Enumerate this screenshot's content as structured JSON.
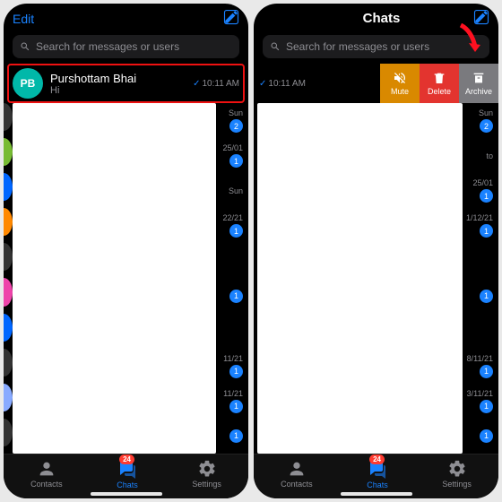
{
  "header": {
    "edit": "Edit",
    "title": "Chats"
  },
  "search": {
    "placeholder": "Search for messages or users"
  },
  "chat": {
    "initials": "PB",
    "name": "Purshottam Bhai",
    "preview": "Hi",
    "timestamp": "10:11 AM",
    "avatar_color": "#00b8a9"
  },
  "swipe": {
    "mute": "Mute",
    "delete": "Delete",
    "archive": "Archive"
  },
  "side_items": [
    {
      "date": "Sun",
      "count": 2
    },
    {
      "date": "25/01",
      "count": 1
    },
    {
      "date": "Sun",
      "count": ""
    },
    {
      "date": "22/21",
      "count": 1
    },
    {
      "date": "",
      "count": ""
    },
    {
      "date": "",
      "count": 1
    },
    {
      "date": "",
      "count": ""
    },
    {
      "date": "11/21",
      "count": 1
    },
    {
      "date": "11/21",
      "count": 1
    },
    {
      "date": "",
      "count": 1
    }
  ],
  "side_items_right": [
    {
      "date": "Sun",
      "count": 2
    },
    {
      "date": "to",
      "count": ""
    },
    {
      "date": "25/01",
      "count": 1
    },
    {
      "date": "1/12/21",
      "count": 1
    },
    {
      "date": "",
      "count": ""
    },
    {
      "date": "",
      "count": 1
    },
    {
      "date": "",
      "count": ""
    },
    {
      "date": "8/11/21",
      "count": 1
    },
    {
      "date": "3/11/21",
      "count": 1
    },
    {
      "date": "",
      "count": 1
    }
  ],
  "edge_colors": [
    "#333",
    "#7b3",
    "#06f",
    "#f80",
    "#333",
    "#e4a",
    "#06f",
    "#333",
    "#8af",
    "#333"
  ],
  "tabs": {
    "contacts": "Contacts",
    "chats": "Chats",
    "settings": "Settings",
    "badge": "24"
  }
}
